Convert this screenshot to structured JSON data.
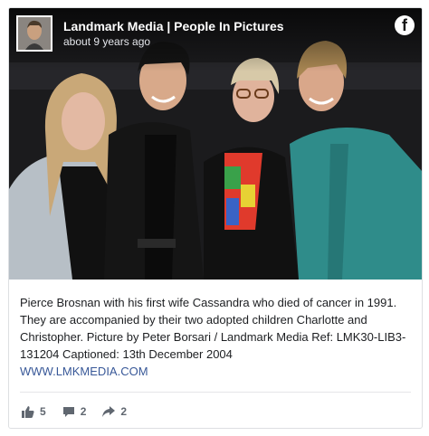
{
  "post": {
    "page_name": "Landmark Media | People In Pictures",
    "timestamp": "about 9 years ago",
    "brand_letter": "f",
    "caption_text": "Pierce Brosnan with his first wife Cassandra who died of cancer in 1991. They are accompanied by their two adopted children Charlotte and Christopher. Picture by Peter Borsari / Landmark Media Ref: LMK30-LIB3-131204 Captioned: 13th December 2004",
    "caption_link": "WWW.LMKMEDIA.COM"
  },
  "actions": {
    "likes": "5",
    "comments": "2",
    "shares": "2"
  },
  "colors": {
    "link": "#385898",
    "text": "#1c1e21",
    "muted": "#606770"
  }
}
